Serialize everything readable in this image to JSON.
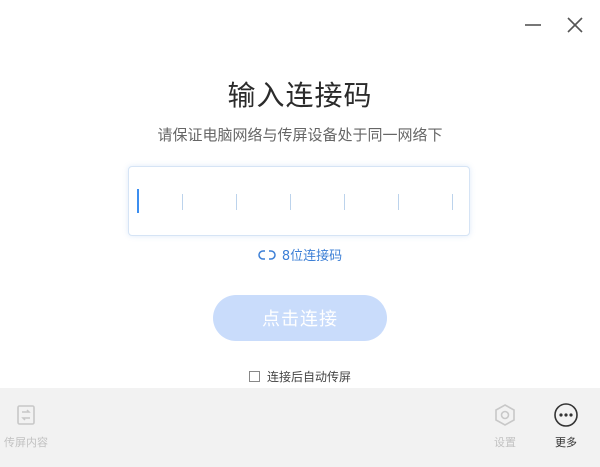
{
  "window": {
    "minimize_label": "minimize",
    "close_label": "close"
  },
  "header": {
    "title": "输入连接码",
    "subtitle": "请保证电脑网络与传屏设备处于同一网络下"
  },
  "code_input": {
    "length": 6,
    "value": ""
  },
  "code_toggle": {
    "label": "8位连接码",
    "icon": "link-icon"
  },
  "connect_button": {
    "label": "点击连接",
    "state": "disabled",
    "color": "#c9dcfb"
  },
  "auto_cast": {
    "label": "连接后自动传屏",
    "checked": false
  },
  "footer": {
    "left": {
      "label": "传屏内容",
      "icon": "cast-content-icon",
      "state": "disabled"
    },
    "settings": {
      "label": "设置",
      "icon": "gear-icon",
      "state": "disabled"
    },
    "more": {
      "label": "更多",
      "icon": "more-icon"
    }
  },
  "colors": {
    "accent": "#3c8ef0",
    "link": "#3c7fd6",
    "footer_bg": "#f2f2f2"
  }
}
